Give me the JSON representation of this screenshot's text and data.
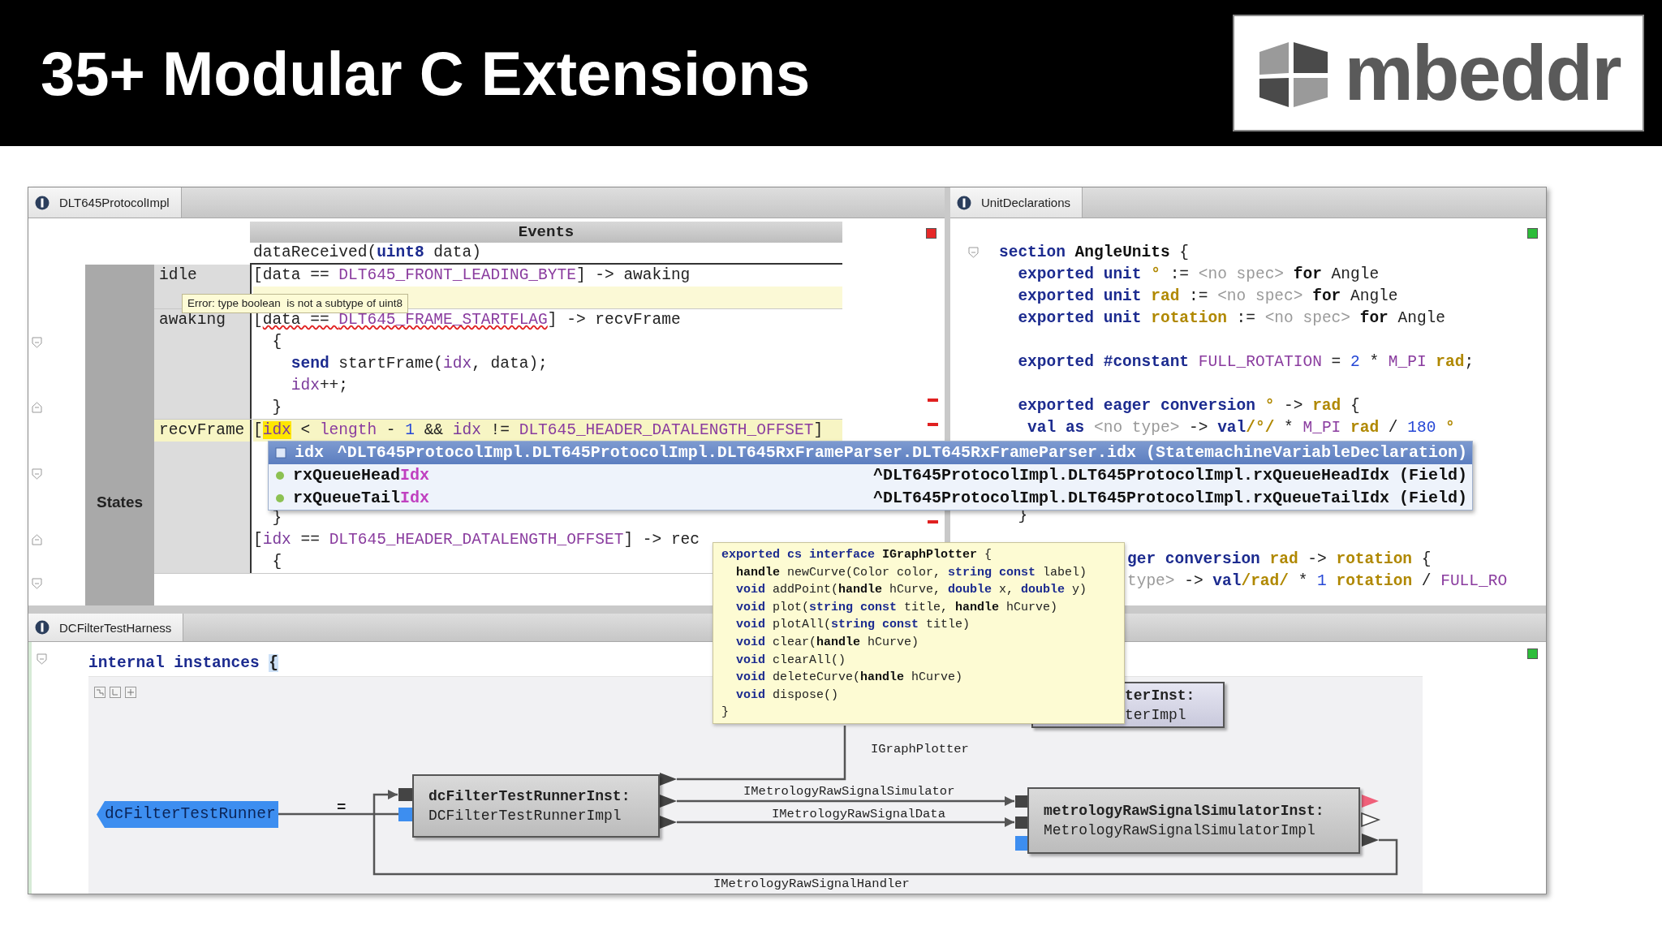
{
  "slide": {
    "title": "35+ Modular C Extensions",
    "logo": "mbeddr"
  },
  "states_pane": {
    "tab": "DLT645ProtocolImpl",
    "has_errors": true,
    "events_header": "Events",
    "states_label": "States",
    "event": [
      {
        "text": "dataReceived(",
        "kind": "plain"
      },
      {
        "text": "uint8",
        "kind": "kw"
      },
      {
        "text": " data)",
        "kind": "plain"
      }
    ],
    "rows": [
      {
        "state": "idle",
        "highlighted": false,
        "lines": [
          {
            "kind": "code",
            "tokens": [
              {
                "text": "[data == ",
                "kind": "plain"
              },
              {
                "text": "DLT645_FRONT_LEADING_BYTE",
                "kind": "const"
              },
              {
                "text": "] -> awaking",
                "kind": "plain"
              }
            ]
          },
          {
            "kind": "error_gap"
          }
        ]
      },
      {
        "state": "awaking",
        "highlighted": false,
        "lines": [
          {
            "kind": "code",
            "tokens": [
              {
                "text": "[",
                "kind": "plain"
              },
              {
                "text": "data == ",
                "kind": "err"
              },
              {
                "text": "DLT645_FRAME_STARTFLAG",
                "kind": "errconst"
              },
              {
                "text": "] -> recvFrame",
                "kind": "plain"
              }
            ]
          },
          {
            "kind": "code",
            "tokens": [
              {
                "text": "  {",
                "kind": "plain"
              }
            ]
          },
          {
            "kind": "code",
            "tokens": [
              {
                "text": "    send",
                "kind": "kw"
              },
              {
                "text": " startFrame(",
                "kind": "plain"
              },
              {
                "text": "idx",
                "kind": "var"
              },
              {
                "text": ", data);",
                "kind": "plain"
              }
            ]
          },
          {
            "kind": "code",
            "tokens": [
              {
                "text": "    idx",
                "kind": "var"
              },
              {
                "text": "++;",
                "kind": "plain"
              }
            ]
          },
          {
            "kind": "code",
            "tokens": [
              {
                "text": "  }",
                "kind": "plain"
              }
            ]
          }
        ]
      },
      {
        "state": "recvFrame",
        "highlighted": true,
        "lines": [
          {
            "kind": "code",
            "tokens": [
              {
                "text": "[",
                "kind": "plain"
              },
              {
                "text": "idx",
                "kind": "cursor"
              },
              {
                "text": " < ",
                "kind": "plain"
              },
              {
                "text": "length",
                "kind": "const"
              },
              {
                "text": " - ",
                "kind": "plain"
              },
              {
                "text": "1",
                "kind": "num"
              },
              {
                "text": " && ",
                "kind": "plain"
              },
              {
                "text": "idx",
                "kind": "var"
              },
              {
                "text": " != ",
                "kind": "plain"
              },
              {
                "text": "DLT645_HEADER_DATALENGTH_OFFSET",
                "kind": "const"
              },
              {
                "text": "]",
                "kind": "plain"
              }
            ]
          },
          {
            "kind": "gap"
          },
          {
            "kind": "gap"
          },
          {
            "kind": "gap"
          },
          {
            "kind": "code",
            "tokens": [
              {
                "text": "  }",
                "kind": "plain"
              }
            ]
          },
          {
            "kind": "code",
            "tokens": [
              {
                "text": "[",
                "kind": "plain"
              },
              {
                "text": "idx",
                "kind": "var"
              },
              {
                "text": " == ",
                "kind": "plain"
              },
              {
                "text": "DLT645_HEADER_DATALENGTH_OFFSET",
                "kind": "const"
              },
              {
                "text": "] -> rec",
                "kind": "plain"
              }
            ]
          },
          {
            "kind": "code",
            "tokens": [
              {
                "text": "  {",
                "kind": "plain"
              }
            ]
          }
        ]
      }
    ]
  },
  "units_pane": {
    "tab": "UnitDeclarations",
    "has_errors": false,
    "lines": [
      {
        "kind": "code",
        "tokens": [
          {
            "text": "section",
            "kind": "kw"
          },
          {
            "text": " AngleUnits",
            "kind": "bold"
          },
          {
            "text": " {",
            "kind": "plain"
          }
        ]
      },
      {
        "kind": "code",
        "tokens": [
          {
            "text": "  exported unit ",
            "kind": "kw"
          },
          {
            "text": "°",
            "kind": "unit"
          },
          {
            "text": " := ",
            "kind": "plain"
          },
          {
            "text": "<no spec>",
            "kind": "gray"
          },
          {
            "text": " for",
            "kind": "bold"
          },
          {
            "text": " Angle",
            "kind": "plain"
          }
        ]
      },
      {
        "kind": "code",
        "tokens": [
          {
            "text": "  exported unit ",
            "kind": "kw"
          },
          {
            "text": "rad",
            "kind": "unit"
          },
          {
            "text": " := ",
            "kind": "plain"
          },
          {
            "text": "<no spec>",
            "kind": "gray"
          },
          {
            "text": " for",
            "kind": "bold"
          },
          {
            "text": " Angle",
            "kind": "plain"
          }
        ]
      },
      {
        "kind": "code",
        "tokens": [
          {
            "text": "  exported unit ",
            "kind": "kw"
          },
          {
            "text": "rotation",
            "kind": "unit"
          },
          {
            "text": " := ",
            "kind": "plain"
          },
          {
            "text": "<no spec>",
            "kind": "gray"
          },
          {
            "text": " for",
            "kind": "bold"
          },
          {
            "text": " Angle",
            "kind": "plain"
          }
        ]
      },
      {
        "kind": "gap"
      },
      {
        "kind": "code",
        "tokens": [
          {
            "text": "  exported #constant ",
            "kind": "kw"
          },
          {
            "text": "FULL_ROTATION",
            "kind": "const"
          },
          {
            "text": " = ",
            "kind": "plain"
          },
          {
            "text": "2",
            "kind": "num"
          },
          {
            "text": " * ",
            "kind": "plain"
          },
          {
            "text": "M_PI",
            "kind": "const"
          },
          {
            "text": " rad",
            "kind": "unit"
          },
          {
            "text": ";",
            "kind": "plain"
          }
        ]
      },
      {
        "kind": "gap"
      },
      {
        "kind": "code",
        "tokens": [
          {
            "text": "  exported eager conversion ",
            "kind": "kw"
          },
          {
            "text": "°",
            "kind": "unit"
          },
          {
            "text": " -> ",
            "kind": "plain"
          },
          {
            "text": "rad",
            "kind": "unit"
          },
          {
            "text": " {",
            "kind": "plain"
          }
        ]
      },
      {
        "kind": "code",
        "tokens": [
          {
            "text": "   val as ",
            "kind": "kw"
          },
          {
            "text": "<no type>",
            "kind": "gray"
          },
          {
            "text": " -> ",
            "kind": "plain"
          },
          {
            "text": "val",
            "kind": "kw"
          },
          {
            "text": "/°/",
            "kind": "unit"
          },
          {
            "text": " * ",
            "kind": "plain"
          },
          {
            "text": "M_PI",
            "kind": "const"
          },
          {
            "text": " rad",
            "kind": "unit"
          },
          {
            "text": " / ",
            "kind": "plain"
          },
          {
            "text": "180",
            "kind": "num"
          },
          {
            "text": " °",
            "kind": "unit"
          }
        ]
      },
      {
        "kind": "gap"
      },
      {
        "kind": "gap"
      },
      {
        "kind": "gap"
      },
      {
        "kind": "code",
        "tokens": [
          {
            "text": "  }",
            "kind": "plain"
          }
        ]
      },
      {
        "kind": "gap"
      },
      {
        "kind": "cut",
        "tokens": [
          {
            "text": "ger conversion ",
            "kind": "kw"
          },
          {
            "text": "rad",
            "kind": "unit"
          },
          {
            "text": " -> ",
            "kind": "plain"
          },
          {
            "text": "rotation",
            "kind": "unit"
          },
          {
            "text": " {",
            "kind": "plain"
          }
        ]
      },
      {
        "kind": "cut",
        "tokens": [
          {
            "text": "type>",
            "kind": "gray"
          },
          {
            "text": " -> ",
            "kind": "plain"
          },
          {
            "text": "val",
            "kind": "kw"
          },
          {
            "text": "/rad/",
            "kind": "unit"
          },
          {
            "text": " * ",
            "kind": "plain"
          },
          {
            "text": "1",
            "kind": "num"
          },
          {
            "text": " rotation",
            "kind": "unit"
          },
          {
            "text": " / ",
            "kind": "plain"
          },
          {
            "text": "FULL_RO",
            "kind": "const"
          }
        ]
      }
    ]
  },
  "error_tooltip": "Error: type boolean  is not a subtype of uint8",
  "completion_popup": [
    {
      "kind": "variable",
      "name": "idx",
      "detail": "^DLT645ProtocolImpl.DLT645ProtocolImpl.DLT645RxFrameParser.DLT645RxFrameParser.idx (StatemachineVariableDeclaration)",
      "selected": true
    },
    {
      "kind": "field",
      "name": "rxQueueHead",
      "match": "Idx",
      "detail": "^DLT645ProtocolImpl.DLT645ProtocolImpl.rxQueueHeadIdx (Field)",
      "selected": false
    },
    {
      "kind": "field",
      "name": "rxQueueTail",
      "match": "Idx",
      "detail": "^DLT645ProtocolImpl.DLT645ProtocolImpl.rxQueueTailIdx (Field)",
      "selected": false
    }
  ],
  "interface_tooltip": [
    [
      {
        "text": "exported cs interface ",
        "kind": "kw"
      },
      {
        "text": "IGraphPlotter",
        "kind": "bold"
      },
      {
        "text": " {",
        "kind": "plain"
      }
    ],
    [
      {
        "text": "  handle",
        "kind": "bold"
      },
      {
        "text": " newCurve(Color color, ",
        "kind": "plain"
      },
      {
        "text": "string const",
        "kind": "kw"
      },
      {
        "text": " label)",
        "kind": "plain"
      }
    ],
    [
      {
        "text": "  void",
        "kind": "kw"
      },
      {
        "text": " addPoint(",
        "kind": "plain"
      },
      {
        "text": "handle",
        "kind": "bold"
      },
      {
        "text": " hCurve, ",
        "kind": "plain"
      },
      {
        "text": "double",
        "kind": "kw"
      },
      {
        "text": " x, ",
        "kind": "plain"
      },
      {
        "text": "double",
        "kind": "kw"
      },
      {
        "text": " y)",
        "kind": "plain"
      }
    ],
    [
      {
        "text": "  void",
        "kind": "kw"
      },
      {
        "text": " plot(",
        "kind": "plain"
      },
      {
        "text": "string const",
        "kind": "kw"
      },
      {
        "text": " title, ",
        "kind": "plain"
      },
      {
        "text": "handle",
        "kind": "bold"
      },
      {
        "text": " hCurve)",
        "kind": "plain"
      }
    ],
    [
      {
        "text": "  void",
        "kind": "kw"
      },
      {
        "text": " plotAll(",
        "kind": "plain"
      },
      {
        "text": "string const",
        "kind": "kw"
      },
      {
        "text": " title)",
        "kind": "plain"
      }
    ],
    [
      {
        "text": "  void",
        "kind": "kw"
      },
      {
        "text": " clear(",
        "kind": "plain"
      },
      {
        "text": "handle",
        "kind": "bold"
      },
      {
        "text": " hCurve)",
        "kind": "plain"
      }
    ],
    [
      {
        "text": "  void",
        "kind": "kw"
      },
      {
        "text": " clearAll()",
        "kind": "plain"
      }
    ],
    [
      {
        "text": "  void",
        "kind": "kw"
      },
      {
        "text": " deleteCurve(",
        "kind": "plain"
      },
      {
        "text": "handle",
        "kind": "bold"
      },
      {
        "text": " hCurve)",
        "kind": "plain"
      }
    ],
    [
      {
        "text": "  void",
        "kind": "kw"
      },
      {
        "text": " dispose()",
        "kind": "plain"
      }
    ],
    [
      {
        "text": "}",
        "kind": "plain"
      }
    ]
  ],
  "harness_pane": {
    "tab": "DCFilterTestHarness",
    "has_errors": false,
    "header": [
      {
        "text": "internal instances ",
        "kind": "kw"
      },
      {
        "text": "{",
        "kind": "match"
      }
    ],
    "assign": "=",
    "nodes": [
      {
        "kind": "ref",
        "label": "dcFilterTestRunner"
      },
      {
        "kind": "instance",
        "name": "dcFilterTestRunnerInst:",
        "type": "DCFilterTestRunnerImpl"
      },
      {
        "kind": "clipped",
        "name": "terInst:",
        "type": "terImpl"
      },
      {
        "kind": "instance",
        "name": "metrologyRawSignalSimulatorInst:",
        "type": "MetrologyRawSignalSimulatorImpl"
      }
    ],
    "connector_labels": [
      "IGraphPlotter",
      "IMetrologyRawSignalSimulator",
      "IMetrologyRawSignalData",
      "IMetrologyRawSignalHandler"
    ]
  }
}
